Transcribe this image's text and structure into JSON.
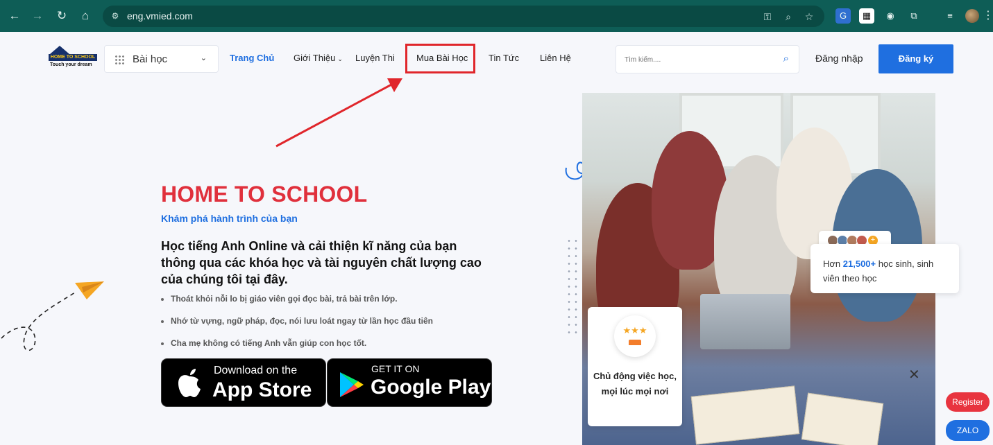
{
  "browser": {
    "url": "eng.vmied.com",
    "icons": [
      "back-icon",
      "forward-icon",
      "reload-icon",
      "home-icon",
      "site-info-icon",
      "password-key-icon",
      "zoom-icon",
      "bookmark-star-icon",
      "translate-icon",
      "qr-icon",
      "camera-icon",
      "extensions-icon",
      "media-icon",
      "profile-avatar",
      "menu-icon"
    ]
  },
  "header": {
    "logo_bar": "HOME TO SCHOOL",
    "logo_tag": "Touch your dream",
    "category_label": "Bài học",
    "nav": [
      {
        "label": "Trang Chủ"
      },
      {
        "label": "Giới Thiệu"
      },
      {
        "label": "Luyện Thi"
      },
      {
        "label": "Mua Bài Học"
      },
      {
        "label": "Tin Tức"
      },
      {
        "label": "Liên Hệ"
      }
    ],
    "search_placeholder": "Tìm kiếm....",
    "login_label": "Đăng nhập",
    "register_label": "Đăng ký"
  },
  "hero": {
    "title": "HOME TO SCHOOL",
    "subtitle": "Khám phá hành trình của bạn",
    "lead": "Học tiếng Anh Online và cải thiện kĩ năng của bạn thông qua các khóa học và tài nguyên chất lượng cao của chúng tôi tại đây.",
    "bullets": [
      "Thoát khỏi nỗi lo bị giáo viên gọi đọc bài, trả bài trên lớp.",
      "Nhớ từ vựng, ngữ pháp, đọc, nói lưu loát ngay từ lần học đầu tiên",
      "Cha mẹ không có tiếng Anh vẫn giúp con học tốt."
    ],
    "app_store": {
      "small": "Download on the",
      "big": "App Store"
    },
    "google_play": {
      "small": "GET IT ON",
      "big": "Google Play"
    }
  },
  "stats": {
    "prefix": "Hơn ",
    "number": "21,500+",
    "suffix": " học sinh, sinh viên theo học"
  },
  "feature": {
    "text": "Chủ động việc học, mọi lúc mọi nơi"
  },
  "floating": {
    "close": "✕",
    "register": "Register",
    "zalo": "ZALO"
  },
  "colors": {
    "chrome": "#0e5d56",
    "accent": "#1f6fe0",
    "title_red": "#e0303c",
    "annotation_red": "#e0262b"
  }
}
